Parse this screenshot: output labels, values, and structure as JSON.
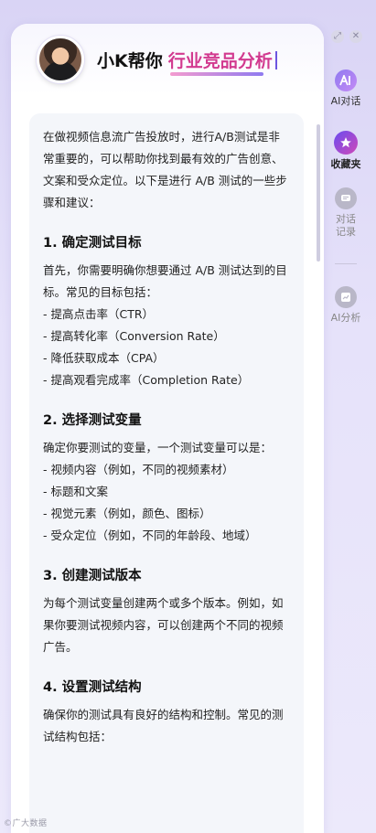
{
  "header": {
    "title_main": "小K帮你",
    "title_accent": "行业竞品分析"
  },
  "intro": "在做视频信息流广告投放时，进行A/B测试是非常重要的，可以帮助你找到最有效的广告创意、文案和受众定位。以下是进行 A/B 测试的一些步骤和建议：",
  "sections": [
    {
      "heading": "1. 确定测试目标",
      "text": "首先，你需要明确你想要通过 A/B 测试达到的目标。常见的目标包括：",
      "items": [
        "- 提高点击率（CTR）",
        "- 提高转化率（Conversion Rate）",
        "- 降低获取成本（CPA）",
        "- 提高观看完成率（Completion Rate）"
      ]
    },
    {
      "heading": "2. 选择测试变量",
      "text": "确定你要测试的变量，一个测试变量可以是：",
      "items": [
        "- 视频内容（例如，不同的视频素材）",
        "- 标题和文案",
        "- 视觉元素（例如，颜色、图标）",
        "- 受众定位（例如，不同的年龄段、地域）"
      ]
    },
    {
      "heading": "3. 创建测试版本",
      "text": "为每个测试变量创建两个或多个版本。例如，如果你要测试视频内容，可以创建两个不同的视频广告。",
      "items": []
    },
    {
      "heading": "4. 设置测试结构",
      "text": "确保你的测试具有良好的结构和控制。常见的测试结构包括：",
      "items": []
    }
  ],
  "rail": {
    "ai_chat": "AI对话",
    "favorites": "收藏夹",
    "history": "对话记录",
    "ai_analysis": "AI分析"
  },
  "window": {
    "pin_glyph": "⤢",
    "close_glyph": "✕"
  },
  "watermark": "©广大数据"
}
